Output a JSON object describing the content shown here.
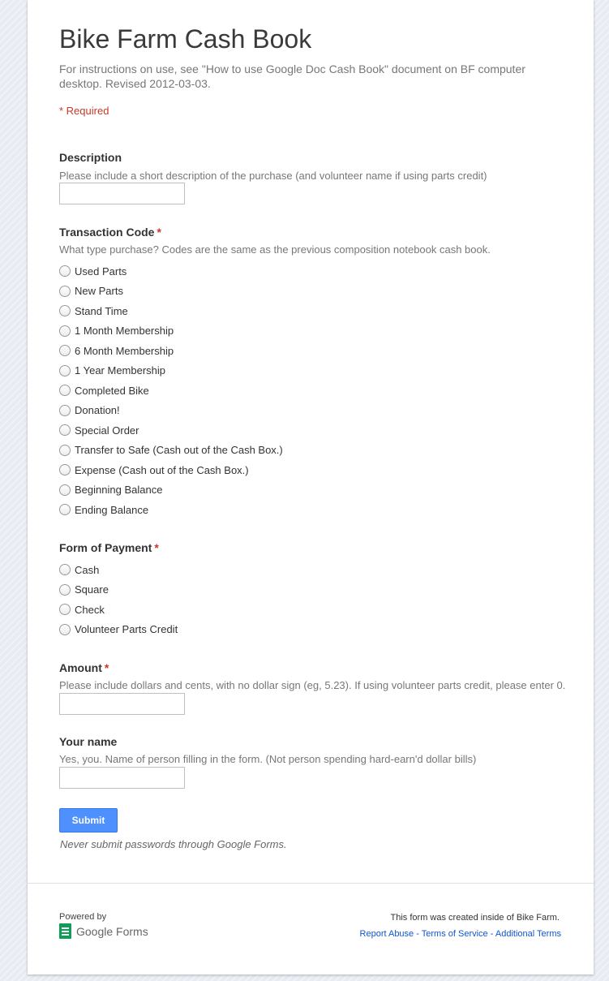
{
  "form": {
    "title": "Bike Farm Cash Book",
    "description": "For instructions on use, see \"How to use Google Doc Cash Book\" document on BF computer desktop.  Revised 2012-03-03.",
    "required_note": "* Required"
  },
  "questions": {
    "description": {
      "title": "Description",
      "help": "Please include a short description of the purchase (and volunteer name if using parts credit)",
      "value": ""
    },
    "transaction_code": {
      "title": "Transaction Code",
      "star": "*",
      "help": "What type purchase? Codes are the same as the previous composition notebook cash book.",
      "options": [
        "Used Parts",
        "New Parts",
        "Stand Time",
        "1 Month Membership",
        "6 Month Membership",
        "1 Year Membership",
        "Completed Bike",
        "Donation!",
        "Special Order",
        "Transfer to Safe (Cash out of the Cash Box.)",
        "Expense (Cash out of the Cash Box.)",
        "Beginning Balance",
        "Ending Balance"
      ]
    },
    "payment": {
      "title": "Form of Payment",
      "star": "*",
      "options": [
        "Cash",
        "Square",
        "Check",
        "Volunteer Parts Credit"
      ]
    },
    "amount": {
      "title": "Amount",
      "star": "*",
      "help": "Please include dollars and cents, with no dollar sign (eg, 5.23). If using volunteer parts credit, please enter 0.",
      "value": ""
    },
    "your_name": {
      "title": "Your name",
      "help": "Yes, you. Name of person filling in the form. (Not person spending hard-earn'd dollar bills)",
      "value": ""
    }
  },
  "submit_label": "Submit",
  "password_warning": "Never submit passwords through Google Forms.",
  "footer": {
    "powered_by": "Powered by",
    "logo_text": "Google Forms",
    "created_note": "This form was created inside of Bike Farm.",
    "links": [
      "Report Abuse",
      "Terms of Service",
      "Additional Terms"
    ],
    "separator": "-"
  },
  "colors": {
    "required": "#c53929",
    "submit": "#4d90fe",
    "link": "#1155cc",
    "logo": "#0f9d58"
  },
  "icons": {
    "logo": "google-forms-icon",
    "radio": "radio-circle"
  }
}
